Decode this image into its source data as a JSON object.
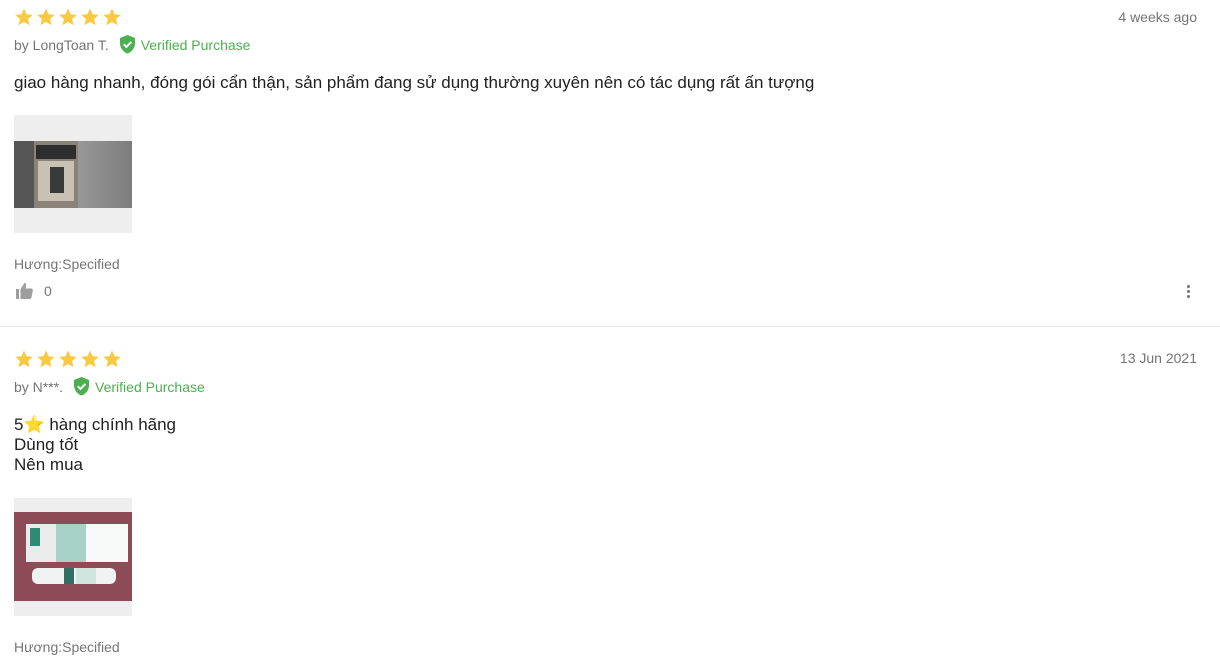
{
  "reviews": [
    {
      "rating": 5,
      "date": "4 weeks ago",
      "author": "by LongToan T.",
      "verified_label": "Verified Purchase",
      "body_lines": [
        "giao hàng nhanh, đóng gói cẩn thận, sản phẩm đang sử dụng thường xuyên nên có tác dụng rất ấn tượng"
      ],
      "variant": "Hương:Specified",
      "like_count": "0"
    },
    {
      "rating": 5,
      "date": "13 Jun 2021",
      "author": "by N***.",
      "verified_label": "Verified Purchase",
      "body_lines": [
        "5⭐ hàng chính hãng",
        "Dùng tốt",
        "Nên mua"
      ],
      "variant": "Hương:Specified"
    }
  ],
  "colors": {
    "star": "#f8c941",
    "verified": "#4caf50",
    "muted_text": "#757575",
    "body_text": "#212121",
    "divider": "#e6e6e6"
  },
  "icons": {
    "rating": "star-icon",
    "verified": "shield-check-icon",
    "like": "thumbs-up-icon",
    "more": "more-vertical-icon"
  }
}
